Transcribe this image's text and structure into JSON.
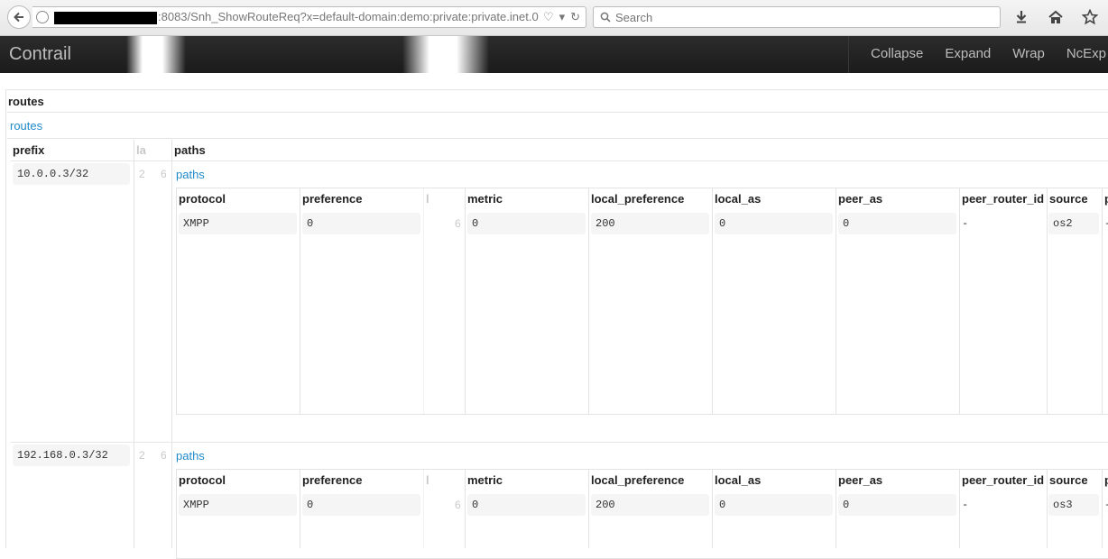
{
  "browser": {
    "url_text": ":8083/Snh_ShowRouteReq?x=default-domain:demo:private:private.inet.0",
    "search_placeholder": "Search"
  },
  "navbar": {
    "brand": "Contrail",
    "items": [
      "Collapse",
      "Expand",
      "Wrap",
      "NcExp"
    ]
  },
  "content": {
    "section_title": "routes",
    "section_link": "routes",
    "columns": {
      "prefix": "prefix",
      "la": "la",
      "paths": "paths"
    },
    "paths_link": "paths",
    "path_columns": [
      "protocol",
      "preference",
      "l",
      "metric",
      "local_preference",
      "local_as",
      "peer_as",
      "peer_router_id",
      "source",
      "p"
    ],
    "routes": [
      {
        "prefix": "10.0.0.3/32",
        "la": "2",
        "la2": "6",
        "path": {
          "protocol": "XMPP",
          "preference": "0",
          "l": "6",
          "metric": "0",
          "local_preference": "200",
          "local_as": "0",
          "peer_as": "0",
          "peer_router_id": "-",
          "source": "os2",
          "p": "-"
        }
      },
      {
        "prefix": "192.168.0.3/32",
        "la": "2",
        "la2": "6",
        "path": {
          "protocol": "XMPP",
          "preference": "0",
          "l": "6",
          "metric": "0",
          "local_preference": "200",
          "local_as": "0",
          "peer_as": "0",
          "peer_router_id": "-",
          "source": "os3",
          "p": "-"
        }
      }
    ]
  }
}
